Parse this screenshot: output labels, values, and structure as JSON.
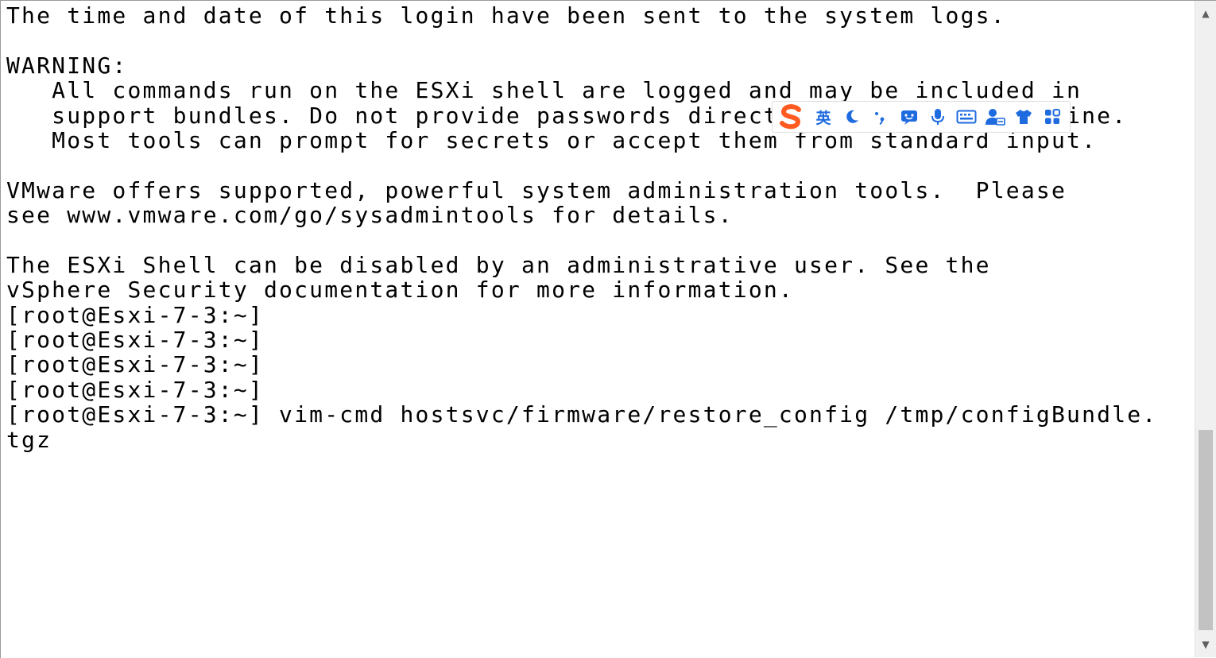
{
  "terminal": {
    "lines": [
      "The time and date of this login have been sent to the system logs.",
      "",
      "WARNING:",
      "   All commands run on the ESXi shell are logged and may be included in",
      "   support bundles. Do not provide passwords directly on the command line.",
      "   Most tools can prompt for secrets or accept them from standard input.",
      "",
      "VMware offers supported, powerful system administration tools.  Please",
      "see www.vmware.com/go/sysadmintools for details.",
      "",
      "The ESXi Shell can be disabled by an administrative user. See the",
      "vSphere Security documentation for more information.",
      "[root@Esxi-7-3:~]",
      "[root@Esxi-7-3:~]",
      "[root@Esxi-7-3:~]",
      "[root@Esxi-7-3:~]",
      "[root@Esxi-7-3:~] vim-cmd hostsvc/firmware/restore_config /tmp/configBundle.",
      "tgz"
    ]
  },
  "ime_toolbar": {
    "logo_icon": "sogou-logo-icon",
    "mode_label": "英",
    "accent_color": "#1e6be0",
    "logo_color": "#ff5a1f",
    "buttons": [
      "moon-icon",
      "punctuation-icon",
      "emoji-icon",
      "microphone-icon",
      "keyboard-icon",
      "user-icon",
      "shirt-icon",
      "apps-grid-icon"
    ]
  },
  "scrollbar": {
    "up_arrow": "▲",
    "down_arrow": "▼"
  },
  "colors": {
    "background": "#ffffff",
    "text": "#000000",
    "scroll_thumb": "#c2c2c2"
  }
}
